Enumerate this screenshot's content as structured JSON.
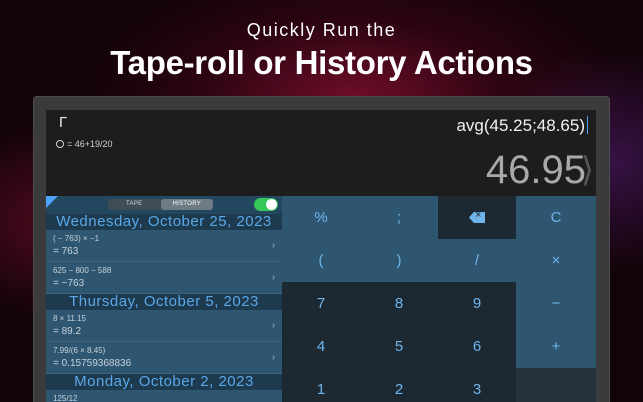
{
  "headline": {
    "sub": "Quickly Run the",
    "main": "Tape-roll or History Actions"
  },
  "display": {
    "cursor": "Γ",
    "expression": "avg(45.25;48.65)",
    "memo": "= 46+19/20",
    "result": "46.95",
    "result_bracket": "⟩"
  },
  "tape": {
    "segments": [
      "TAPE",
      "HISTORY"
    ],
    "active_segment": "HISTORY",
    "toggle_on": true,
    "groups": [
      {
        "date": "Wednesday, October 25, 2023",
        "entries": [
          {
            "expr": "( − 763) × −1",
            "result": "= 763"
          },
          {
            "expr": "625 − 800 − 588",
            "result": "= −763"
          }
        ]
      },
      {
        "date": "Thursday, October 5, 2023",
        "entries": [
          {
            "expr": "8 × 11.15",
            "result": "= 89.2"
          },
          {
            "expr": "7.99/(6 × 8.45)",
            "result": "= 0.15759368836"
          }
        ]
      },
      {
        "date": "Monday, October 2, 2023",
        "entries": [
          {
            "expr": "125/12",
            "result": ""
          }
        ]
      }
    ],
    "chevron": "›"
  },
  "keypad": {
    "row1": [
      "%",
      ";",
      "backspace",
      "C"
    ],
    "row2": [
      "(",
      ")",
      "/",
      "×"
    ],
    "row3": [
      "7",
      "8",
      "9",
      "−"
    ],
    "row4": [
      "4",
      "5",
      "6",
      "+"
    ],
    "row5": [
      "1",
      "2",
      "3",
      ""
    ]
  },
  "colors": {
    "accent": "#6fb5ec",
    "toggle": "#34c759",
    "date_text": "#5aa7e8"
  }
}
